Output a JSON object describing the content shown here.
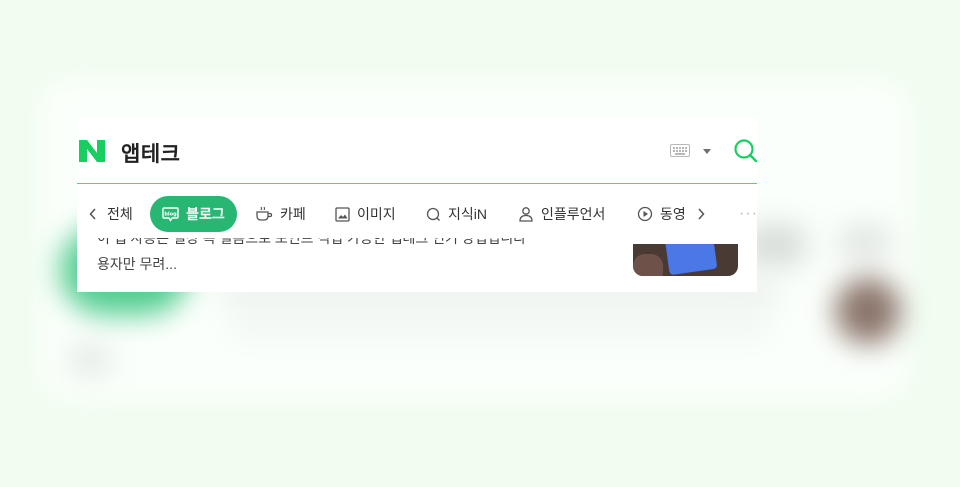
{
  "search": {
    "query": "앱테크"
  },
  "tabs": [
    {
      "label": "전체"
    },
    {
      "label": "블로그"
    },
    {
      "label": "카페"
    },
    {
      "label": "이미지"
    },
    {
      "label": "지식iN"
    },
    {
      "label": "인플루언서"
    },
    {
      "label": "동영"
    }
  ],
  "result": {
    "snippet_top": "이 앱 사용은 일상 속 걸음으로 포인트 적립 가능한 앱테크 인기 방법입니다",
    "snippet_bottom": "용자만 무려..."
  },
  "colors": {
    "brand": "#19ce60",
    "active_tab": "#28b773"
  },
  "icons": [
    "naver-logo-icon",
    "keyboard-icon",
    "dropdown-caret-icon",
    "search-icon",
    "chevron-left-icon",
    "blog-icon",
    "cafe-cup-icon",
    "image-icon",
    "kin-icon",
    "person-icon",
    "play-icon",
    "chevron-right-icon",
    "more-dots-icon"
  ]
}
